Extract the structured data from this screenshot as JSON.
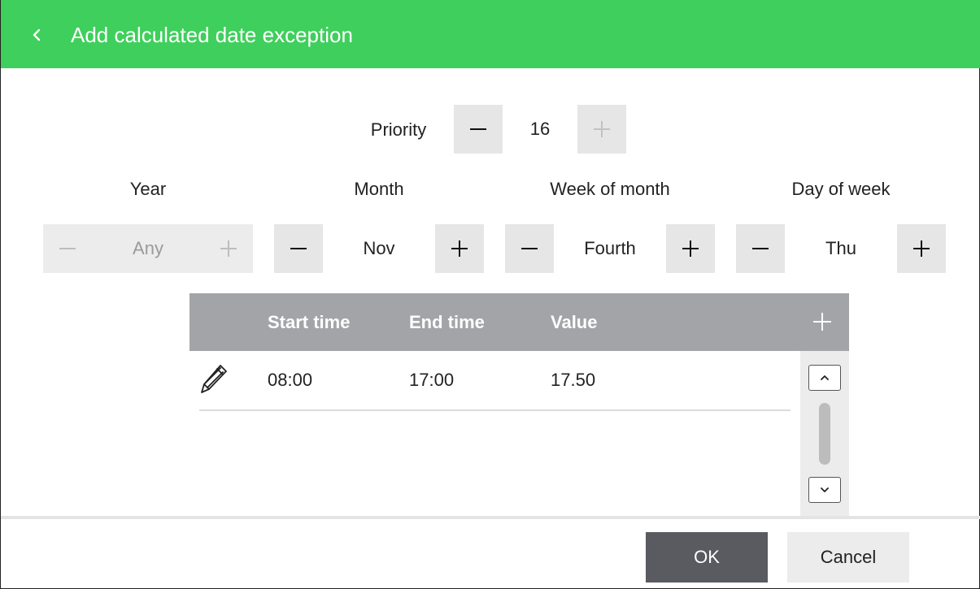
{
  "header": {
    "back_icon": "chevron-left-icon",
    "title": "Add calculated date exception"
  },
  "priority": {
    "label": "Priority",
    "value": "16",
    "decrement_enabled": true,
    "increment_enabled": false
  },
  "fields": [
    {
      "label": "Year",
      "value": "Any",
      "enabled": false
    },
    {
      "label": "Month",
      "value": "Nov",
      "enabled": true
    },
    {
      "label": "Week of month",
      "value": "Fourth",
      "enabled": true
    },
    {
      "label": "Day of week",
      "value": "Thu",
      "enabled": true
    }
  ],
  "table": {
    "columns": [
      "Start time",
      "End time",
      "Value"
    ],
    "add_icon": "plus-icon",
    "rows": [
      {
        "edit_icon": "pencil-icon",
        "start_time": "08:00",
        "end_time": "17:00",
        "value": "17.50"
      }
    ]
  },
  "scrollbar": {
    "up_icon": "chevron-up-icon",
    "down_icon": "chevron-down-icon"
  },
  "footer": {
    "ok_label": "OK",
    "cancel_label": "Cancel"
  },
  "colors": {
    "header_bg": "#3fcf5c",
    "table_header_bg": "#a3a4a8",
    "ok_bg": "#5a5b60",
    "cancel_bg": "#ececec",
    "stepper_bg": "#e6e6e6"
  }
}
